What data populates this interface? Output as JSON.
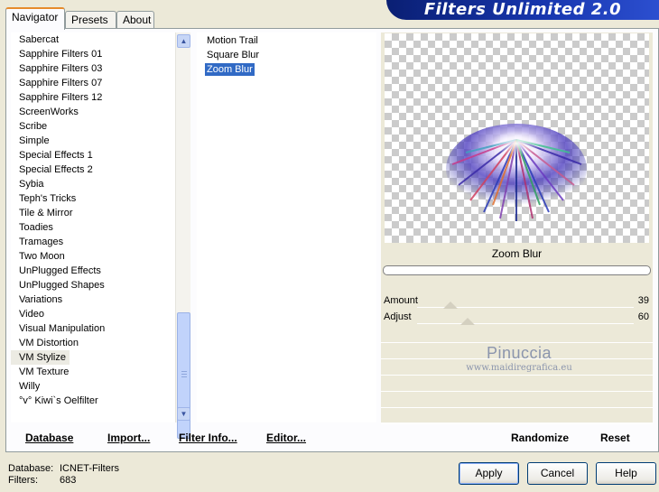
{
  "tabs": [
    {
      "label": "Navigator",
      "active": true
    },
    {
      "label": "Presets",
      "active": false
    },
    {
      "label": "About",
      "active": false
    }
  ],
  "banner": {
    "title": "Filters Unlimited 2.0"
  },
  "categories": [
    "Sabercat",
    "Sapphire Filters 01",
    "Sapphire Filters 03",
    "Sapphire Filters 07",
    "Sapphire Filters 12",
    "ScreenWorks",
    "Scribe",
    "Simple",
    "Special Effects 1",
    "Special Effects 2",
    "Sybia",
    "Teph's Tricks",
    "Tile & Mirror",
    "Toadies",
    "Tramages",
    "Two Moon",
    "UnPlugged Effects",
    "UnPlugged Shapes",
    "Variations",
    "Video",
    "Visual Manipulation",
    "VM Distortion",
    "VM Stylize",
    "VM Texture",
    "Willy",
    "°v° Kiwi`s Oelfilter"
  ],
  "selected_category": "VM Stylize",
  "filters": [
    "Motion Trail",
    "Square Blur",
    "Zoom Blur"
  ],
  "selected_filter": "Zoom Blur",
  "filter_panel": {
    "title": "Zoom Blur",
    "params": [
      {
        "label": "Amount",
        "value": "39",
        "fraction": 0.153
      },
      {
        "label": "Adjust",
        "value": "60",
        "fraction": 0.235
      }
    ]
  },
  "watermark": {
    "name": "Pinuccia",
    "url": "www.maidiregrafica.eu"
  },
  "bottom_links": {
    "database": "Database",
    "import": "Import...",
    "filter_info": "Filter Info...",
    "editor": "Editor...",
    "randomize": "Randomize",
    "reset": "Reset"
  },
  "status": {
    "database_label": "Database:",
    "database_value": "ICNET-Filters",
    "filters_label": "Filters:",
    "filters_value": "683"
  },
  "buttons": {
    "apply": "Apply",
    "cancel": "Cancel",
    "help": "Help"
  },
  "colors": {
    "banner": "#1837b0",
    "selection": "#316ac5",
    "tab_highlight": "#e68b2c"
  },
  "icons": {
    "scroll_up": "chevron-up-icon",
    "scroll_down": "chevron-down-icon"
  }
}
